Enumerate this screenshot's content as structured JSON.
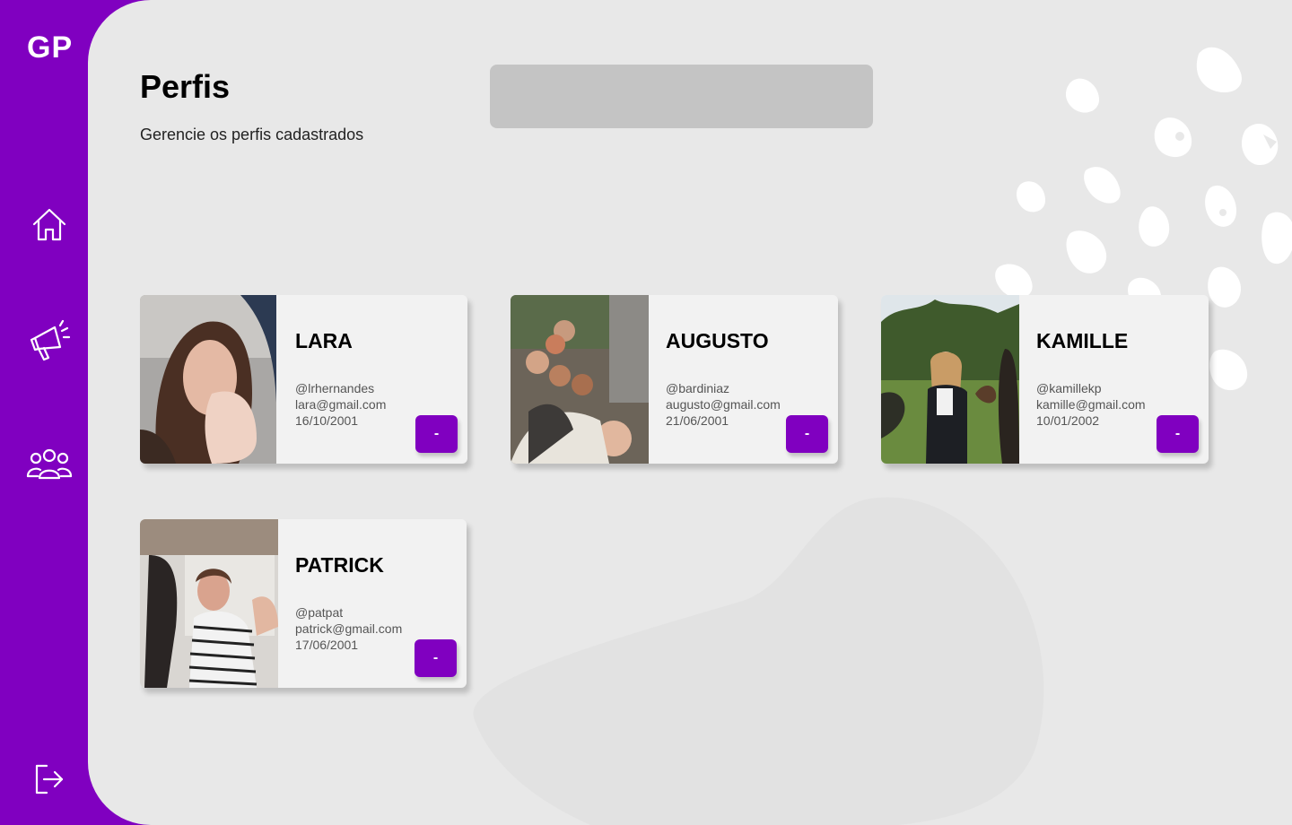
{
  "app": {
    "logo": "GP",
    "accent": "#8000c0"
  },
  "sidebar": {
    "items": [
      {
        "icon": "home-icon"
      },
      {
        "icon": "megaphone-icon"
      },
      {
        "icon": "users-icon"
      }
    ],
    "logout_icon": "logout-icon"
  },
  "header": {
    "title": "Perfis",
    "subtitle": "Gerencie os perfis cadastrados",
    "search_placeholder": ""
  },
  "profiles": [
    {
      "name": "LARA",
      "username": "@lrhernandes",
      "email": "lara@gmail.com",
      "birth": "16/10/2001",
      "button_label": "-"
    },
    {
      "name": "AUGUSTO",
      "username": "@bardiniaz",
      "email": "augusto@gmail.com",
      "birth": "21/06/2001",
      "button_label": "-"
    },
    {
      "name": "KAMILLE",
      "username": "@kamillekp",
      "email": "kamille@gmail.com",
      "birth": "10/01/2002",
      "button_label": "-"
    },
    {
      "name": "PATRICK",
      "username": "@patpat",
      "email": "patrick@gmail.com",
      "birth": "17/06/2001",
      "button_label": "-"
    }
  ]
}
